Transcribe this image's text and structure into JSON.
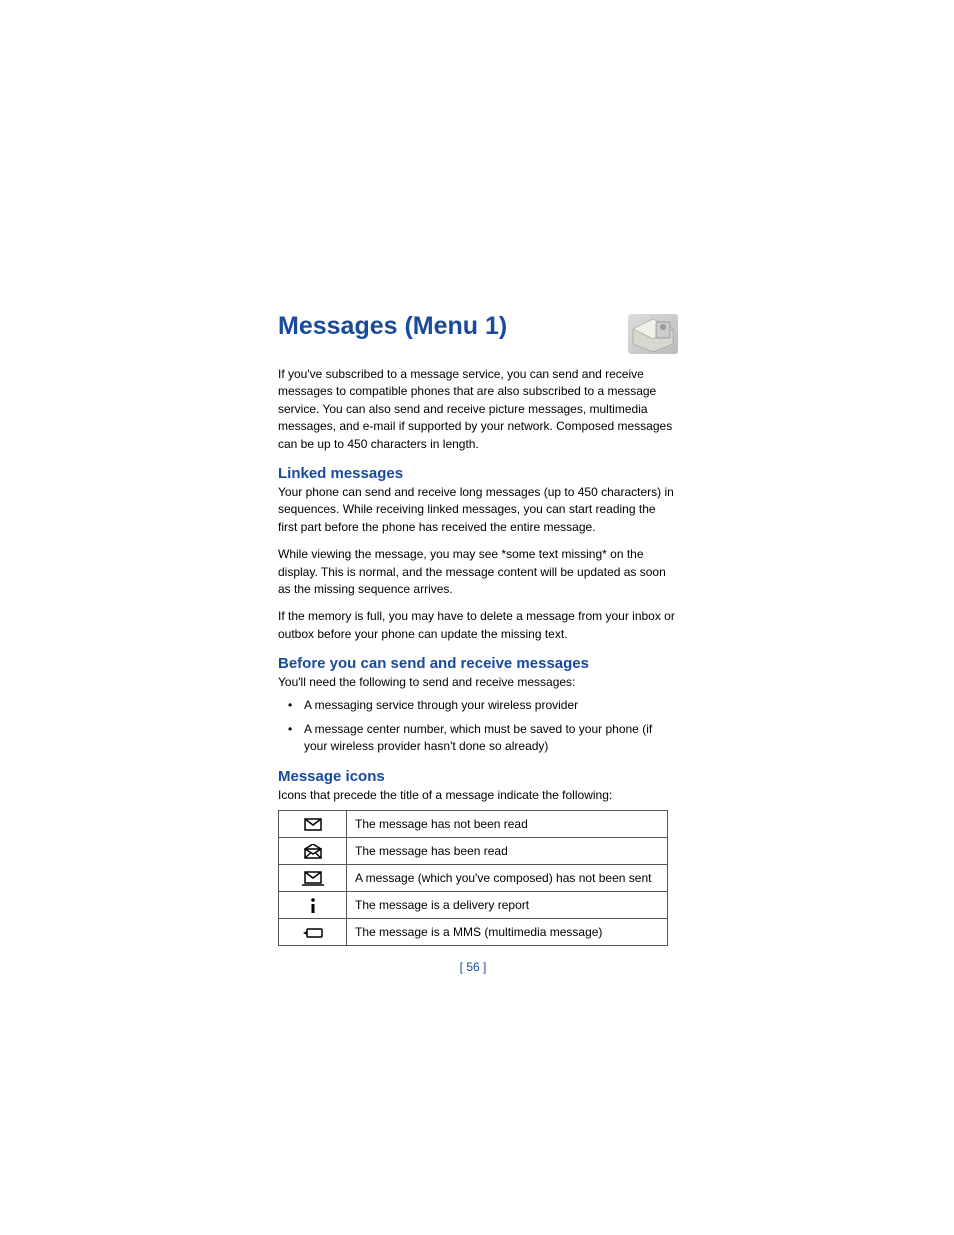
{
  "title": "Messages (Menu 1)",
  "intro": "If you've subscribed to a message service, you can send and receive messages to compatible phones that are also subscribed to a message service. You can also send and receive picture messages, multimedia messages, and e-mail if supported by your network. Composed messages can be up to 450 characters in length.",
  "sections": {
    "linked": {
      "title": "Linked messages",
      "p1": "Your phone can send and receive long messages (up to 450 characters) in sequences. While receiving linked messages, you can start reading the first part before the phone has received the entire message.",
      "p2": "While viewing the message, you may see *some text missing* on the display. This is normal, and the message content will be updated as soon as the missing sequence arrives.",
      "p3": "If the memory is full, you may have to delete a message from your inbox or outbox before your phone can update the missing text."
    },
    "before": {
      "title": "Before you can send and receive messages",
      "intro": "You'll need the following to send and receive messages:",
      "bullets": [
        "A messaging service through your wireless provider",
        "A message center number, which must be saved to your phone (if your wireless provider hasn't done so already)"
      ]
    },
    "icons": {
      "title": "Message icons",
      "intro": "Icons that precede the title of a message indicate the following:",
      "rows": [
        {
          "icon": "envelope-icon",
          "desc": "The message has not been read"
        },
        {
          "icon": "envelope-open-icon",
          "desc": "The message has been read"
        },
        {
          "icon": "envelope-outbox-icon",
          "desc": "A message (which you've composed) has not been sent"
        },
        {
          "icon": "info-icon",
          "desc": "The message is a delivery report"
        },
        {
          "icon": "mms-icon",
          "desc": "The message is a MMS (multimedia message)"
        }
      ]
    }
  },
  "page_number": "[ 56 ]"
}
